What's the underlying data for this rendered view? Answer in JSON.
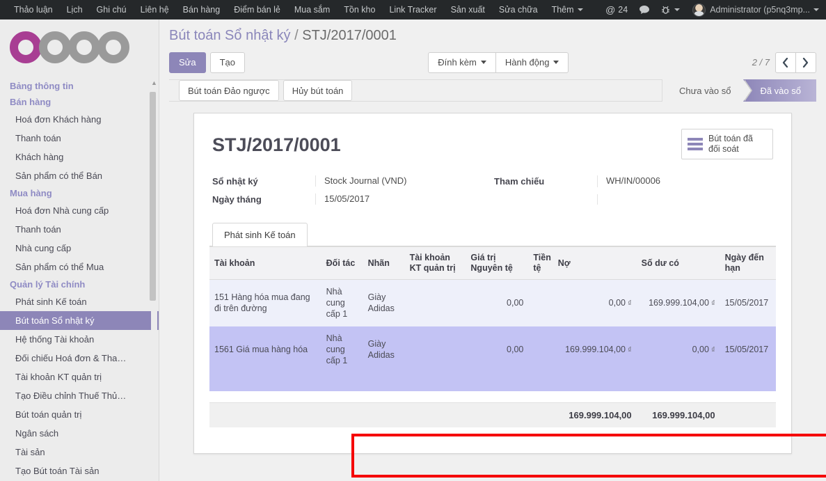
{
  "topbar": {
    "menu_items": [
      "Thảo luận",
      "Lịch",
      "Ghi chú",
      "Liên hệ",
      "Bán hàng",
      "Điểm bán lẻ",
      "Mua sắm",
      "Tồn kho",
      "Link Tracker",
      "Sản xuất",
      "Sửa chữa"
    ],
    "more_label": "Thêm",
    "mention_icon": "at-icon",
    "mention_count": "24",
    "messages_icon": "chat-bubble-icon",
    "debug_icon": "bug-icon",
    "avatar_icon": "user-avatar",
    "user_label": "Administrator (p5nq3mp..."
  },
  "sidebar": {
    "logo_text": "odoo",
    "sections": [
      {
        "title": "Bảng thông tin",
        "items": []
      },
      {
        "title": "Bán hàng",
        "items": [
          {
            "label": "Hoá đơn Khách hàng",
            "active": false
          },
          {
            "label": "Thanh toán",
            "active": false
          },
          {
            "label": "Khách hàng",
            "active": false
          },
          {
            "label": "Sản phẩm có thể Bán",
            "active": false
          }
        ]
      },
      {
        "title": "Mua hàng",
        "items": [
          {
            "label": "Hoá đơn Nhà cung cấp",
            "active": false
          },
          {
            "label": "Thanh toán",
            "active": false
          },
          {
            "label": "Nhà cung cấp",
            "active": false
          },
          {
            "label": "Sản phẩm có thể Mua",
            "active": false
          }
        ]
      },
      {
        "title": "Quản lý Tài chính",
        "items": [
          {
            "label": "Phát sinh Kế toán",
            "active": false
          },
          {
            "label": "Bút toán Sổ nhật ký",
            "active": true
          },
          {
            "label": "Hệ thống Tài khoản",
            "active": false
          },
          {
            "label": "Đối chiếu Hoá đơn & Tha…",
            "active": false
          },
          {
            "label": "Tài khoản KT quản trị",
            "active": false
          },
          {
            "label": "Tạo Điều chỉnh Thuế Thủ…",
            "active": false
          },
          {
            "label": "Bút toán quản trị",
            "active": false
          },
          {
            "label": "Ngân sách",
            "active": false
          },
          {
            "label": "Tài sản",
            "active": false
          },
          {
            "label": "Tạo Bút toán Tài sản",
            "active": false
          }
        ]
      }
    ]
  },
  "control_panel": {
    "breadcrumb_root": "Bút toán Sổ nhật ký",
    "breadcrumb_sep": "/",
    "breadcrumb_current": "STJ/2017/0001",
    "edit_label": "Sửa",
    "create_label": "Tạo",
    "attachment_label": "Đính kèm",
    "action_label": "Hành động",
    "pager_text": "2 / 7",
    "prev_icon": "chevron-left-icon",
    "next_icon": "chevron-right-icon"
  },
  "status_bar": {
    "buttons": [
      "Bút toán Đảo ngược",
      "Hủy bút toán"
    ],
    "stages": [
      {
        "label": "Chưa vào sổ",
        "current": false
      },
      {
        "label": "Đã vào sổ",
        "current": true
      }
    ]
  },
  "sheet": {
    "stat_button": {
      "icon": "bars-icon",
      "label": "Bút toán đã đối soát"
    },
    "title": "STJ/2017/0001",
    "fields_left": [
      {
        "label": "Sổ nhật ký",
        "value": "Stock Journal (VND)"
      },
      {
        "label": "Ngày tháng",
        "value": "15/05/2017"
      }
    ],
    "fields_right": [
      {
        "label": "Tham chiếu",
        "value": "WH/IN/00006"
      }
    ],
    "tabs": [
      {
        "label": "Phát sinh Kế toán",
        "active": true
      }
    ],
    "table": {
      "columns": [
        "Tài khoản",
        "Đối tác",
        "Nhãn",
        "Tài khoản KT quản trị",
        "Giá trị Nguyên tệ",
        "Tiền tệ",
        "Nợ",
        "Số dư có",
        "Ngày đến hạn"
      ],
      "rows": [
        {
          "account": "151 Hàng hóa mua đang đi trên đường",
          "partner": "Nhà cung cấp 1",
          "label": "Giày Adidas",
          "analytic_account": "",
          "amount_currency": "0,00",
          "currency": "",
          "debit": "0,00",
          "debit_symbol": "₫",
          "credit": "169.999.104,00",
          "credit_symbol": "₫",
          "due_date": "15/05/2017",
          "selected": false
        },
        {
          "account": "1561 Giá mua hàng hóa",
          "partner": "Nhà cung cấp 1",
          "label": "Giày Adidas",
          "analytic_account": "",
          "amount_currency": "0,00",
          "currency": "",
          "debit": "169.999.104,00",
          "debit_symbol": "₫",
          "credit": "0,00",
          "credit_symbol": "₫",
          "due_date": "15/05/2017",
          "selected": true
        }
      ],
      "totals": {
        "debit": "169.999.104,00",
        "credit": "169.999.104,00"
      }
    }
  },
  "annotation": {
    "highlight_color": "#f50000",
    "highlight_target": "selected-journal-line"
  }
}
